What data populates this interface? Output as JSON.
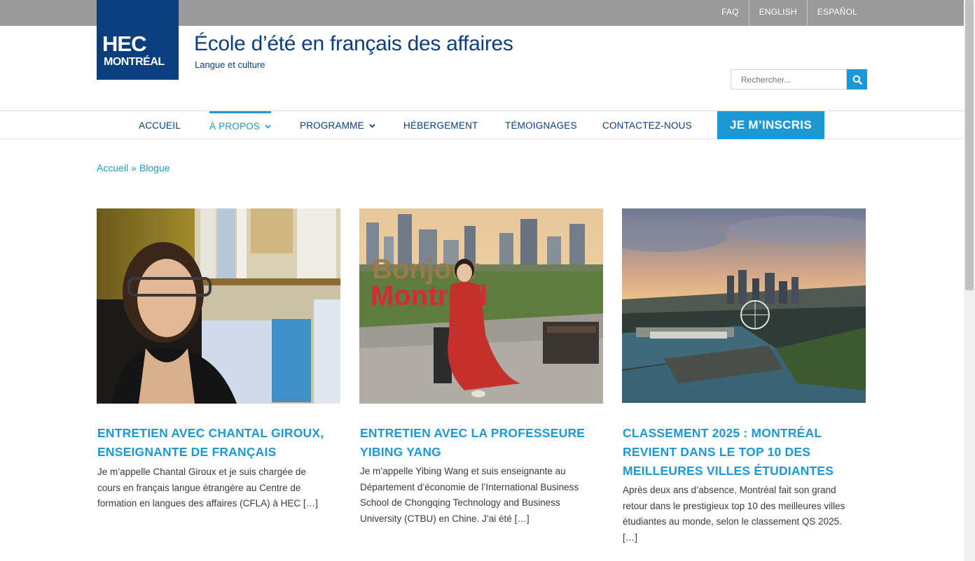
{
  "topbar": {
    "links": [
      "FAQ",
      "ENGLISH",
      "ESPAÑOL"
    ]
  },
  "logo": {
    "line1": "HEC",
    "line2": "MONTRÉAL"
  },
  "site": {
    "title": "École d’été en français des affaires",
    "subtitle": "Langue et culture"
  },
  "search": {
    "placeholder": "Rechercher..."
  },
  "nav": {
    "items": [
      "ACCUEIL",
      "À PROPOS",
      "PROGRAMME",
      "HÉBERGEMENT",
      "TÉMOIGNAGES",
      "CONTACTEZ-NOUS"
    ],
    "cta": "JE M’INSCRIS",
    "active": "À PROPOS"
  },
  "breadcrumb": {
    "home": "Accueil",
    "separator": "»",
    "current": "Blogue"
  },
  "posts": [
    {
      "title": "ENTRETIEN AVEC CHANTAL GIROUX, ENSEIGNANTE DE FRANÇAIS",
      "excerpt": "Je m’appelle Chantal Giroux et je suis chargée de cours en français langue étrangère au Centre de formation en langues des affaires (CFLA) à HEC […]"
    },
    {
      "title": "ENTRETIEN AVEC LA PROFESSEURE YIBING YANG",
      "excerpt": "Je m’appelle Yibing Wang et suis enseignante au Département d’économie de l’International Business School de Chongqing Technology and Business University (CTBU) en Chine. J’ai été […]"
    },
    {
      "title": "CLASSEMENT 2025 : MONTRÉAL REVIENT DANS LE TOP 10 DES MEILLEURES VILLES ÉTUDIANTES",
      "excerpt": "Après deux ans d’absence, Montréal fait son grand retour dans le prestigieux top 10 des meilleures villes étudiantes au monde, selon le classement QS 2025. […]"
    }
  ],
  "colors": {
    "primary_blue": "#1e98d5",
    "navy": "#0a3e7c",
    "topbar_gray": "#9a9a9a"
  }
}
